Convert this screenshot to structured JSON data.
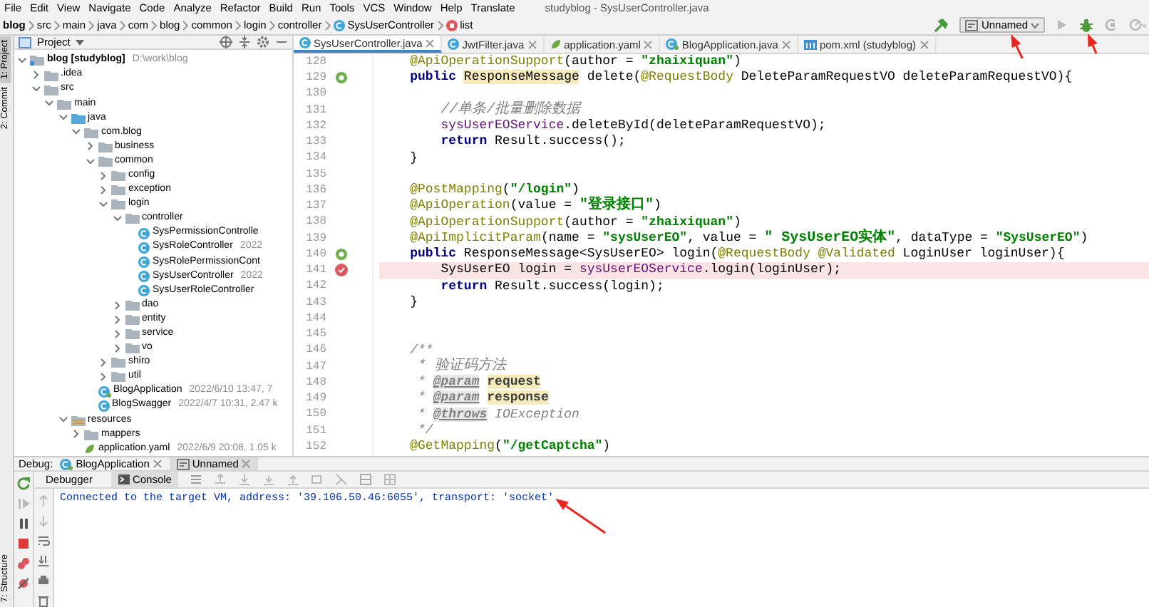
{
  "menu_bar": {
    "items": [
      "File",
      "Edit",
      "View",
      "Navigate",
      "Code",
      "Analyze",
      "Refactor",
      "Build",
      "Run",
      "Tools",
      "VCS",
      "Window",
      "Help",
      "Translate"
    ],
    "title": "studyblog - SysUserController.java"
  },
  "breadcrumbs": [
    {
      "label": "blog",
      "kind": "module"
    },
    {
      "label": "src",
      "kind": "folder"
    },
    {
      "label": "main",
      "kind": "folder"
    },
    {
      "label": "java",
      "kind": "folder"
    },
    {
      "label": "com",
      "kind": "folder"
    },
    {
      "label": "blog",
      "kind": "folder"
    },
    {
      "label": "common",
      "kind": "folder"
    },
    {
      "label": "login",
      "kind": "folder"
    },
    {
      "label": "controller",
      "kind": "folder"
    },
    {
      "label": "SysUserController",
      "kind": "class"
    },
    {
      "label": "list",
      "kind": "method"
    }
  ],
  "run_toolbar": {
    "configuration": "Unnamed"
  },
  "tool_stripe": {
    "top": [
      {
        "label": "1: Project",
        "selected": true
      },
      {
        "label": "2: Commit",
        "selected": false
      }
    ],
    "bottom": [
      {
        "label": "7: Structure",
        "selected": false
      }
    ]
  },
  "project_panel": {
    "title": "Project",
    "tree": [
      {
        "label": "blog [studyblog]",
        "kind": "module",
        "meta": "D:\\work\\blog",
        "expanded": true,
        "children": [
          {
            "label": ".idea",
            "kind": "folder",
            "expanded": false
          },
          {
            "label": "src",
            "kind": "folder",
            "expanded": true,
            "children": [
              {
                "label": "main",
                "kind": "folder",
                "expanded": true,
                "children": [
                  {
                    "label": "java",
                    "kind": "source",
                    "expanded": true,
                    "children": [
                      {
                        "label": "com.blog",
                        "kind": "folder",
                        "expanded": true,
                        "children": [
                          {
                            "label": "business",
                            "kind": "folder",
                            "expanded": false
                          },
                          {
                            "label": "common",
                            "kind": "folder",
                            "expanded": true,
                            "children": [
                              {
                                "label": "config",
                                "kind": "folder",
                                "expanded": false
                              },
                              {
                                "label": "exception",
                                "kind": "folder",
                                "expanded": false
                              },
                              {
                                "label": "login",
                                "kind": "folder",
                                "expanded": true,
                                "children": [
                                  {
                                    "label": "controller",
                                    "kind": "folder",
                                    "expanded": true,
                                    "children": [
                                      {
                                        "label": "SysPermissionControlle",
                                        "kind": "class"
                                      },
                                      {
                                        "label": "SysRoleController",
                                        "kind": "class",
                                        "meta": "2022"
                                      },
                                      {
                                        "label": "SysRolePermissionCont",
                                        "kind": "class"
                                      },
                                      {
                                        "label": "SysUserController",
                                        "kind": "class",
                                        "meta": "2022"
                                      },
                                      {
                                        "label": "SysUserRoleController",
                                        "kind": "class"
                                      }
                                    ]
                                  },
                                  {
                                    "label": "dao",
                                    "kind": "folder",
                                    "expanded": false
                                  },
                                  {
                                    "label": "entity",
                                    "kind": "folder",
                                    "expanded": false
                                  },
                                  {
                                    "label": "service",
                                    "kind": "folder",
                                    "expanded": false
                                  },
                                  {
                                    "label": "vo",
                                    "kind": "folder",
                                    "expanded": false
                                  }
                                ]
                              },
                              {
                                "label": "shiro",
                                "kind": "folder",
                                "expanded": false
                              },
                              {
                                "label": "util",
                                "kind": "folder",
                                "expanded": false
                              }
                            ]
                          },
                          {
                            "label": "BlogApplication",
                            "kind": "spring",
                            "meta": "2022/6/10 13:47, 7"
                          },
                          {
                            "label": "BlogSwagger",
                            "kind": "class",
                            "meta": "2022/4/7 10:31, 2.47 k"
                          }
                        ]
                      }
                    ]
                  },
                  {
                    "label": "resources",
                    "kind": "resources",
                    "expanded": true,
                    "children": [
                      {
                        "label": "mappers",
                        "kind": "folder",
                        "expanded": false
                      },
                      {
                        "label": "application.yaml",
                        "kind": "yaml",
                        "meta": "2022/6/9 20:08, 1.05 k"
                      }
                    ]
                  }
                ]
              }
            ]
          }
        ]
      }
    ]
  },
  "editor": {
    "tabs": [
      {
        "label": "SysUserController.java",
        "kind": "class",
        "selected": true
      },
      {
        "label": "JwtFilter.java",
        "kind": "class",
        "selected": false
      },
      {
        "label": "application.yaml",
        "kind": "yaml",
        "selected": false
      },
      {
        "label": "BlogApplication.java",
        "kind": "spring",
        "selected": false
      },
      {
        "label": "pom.xml (studyblog)",
        "kind": "maven",
        "selected": false
      }
    ],
    "lines": [
      {
        "number": "128",
        "kind": "plain",
        "breakpoint": false,
        "segments": [
          {
            "text": "    @ApiOperationSupport",
            "kind": "ann"
          },
          {
            "text": "(author = ",
            "kind": "plain"
          },
          {
            "text": "\"zhaixiquan\"",
            "kind": "str"
          },
          {
            "text": ")",
            "kind": "plain"
          }
        ]
      },
      {
        "number": "129",
        "kind": "bean",
        "breakpoint": false,
        "segments": [
          {
            "text": "    public",
            "kind": "kw"
          },
          {
            "text": " ResponseMessage",
            "kind": "hl"
          },
          {
            "text": " delete(",
            "kind": "plain"
          },
          {
            "text": "@RequestBody",
            "kind": "ann"
          },
          {
            "text": " DeleteParamRequestVO deleteParamRequestVO){",
            "kind": "plain"
          }
        ]
      },
      {
        "number": "130",
        "kind": "plain",
        "breakpoint": false
      },
      {
        "number": "131",
        "kind": "plain",
        "breakpoint": false,
        "segments": [
          {
            "text": "        //单条/批量删除数据",
            "kind": "cmt"
          }
        ]
      },
      {
        "number": "132",
        "kind": "plain",
        "breakpoint": false,
        "segments": [
          {
            "text": "        sysUserEOService",
            "kind": "field"
          },
          {
            "text": ".deleteById(deleteParamRequestVO);",
            "kind": "plain"
          }
        ]
      },
      {
        "number": "133",
        "kind": "plain",
        "breakpoint": false,
        "segments": [
          {
            "text": "        return",
            "kind": "kw"
          },
          {
            "text": " Result.success();",
            "kind": "plain"
          }
        ]
      },
      {
        "number": "134",
        "kind": "plain",
        "breakpoint": false,
        "segments": [
          {
            "text": "    }",
            "kind": "plain"
          }
        ]
      },
      {
        "number": "135",
        "kind": "plain",
        "breakpoint": false
      },
      {
        "number": "136",
        "kind": "plain",
        "breakpoint": false,
        "segments": [
          {
            "text": "    @PostMapping",
            "kind": "ann"
          },
          {
            "text": "(",
            "kind": "plain"
          },
          {
            "text": "\"/login\"",
            "kind": "str"
          },
          {
            "text": ")",
            "kind": "plain"
          }
        ]
      },
      {
        "number": "137",
        "kind": "plain",
        "breakpoint": false,
        "segments": [
          {
            "text": "    @ApiOperation",
            "kind": "ann"
          },
          {
            "text": "(value = ",
            "kind": "plain"
          },
          {
            "text": "\"登录接口\"",
            "kind": "str"
          },
          {
            "text": ")",
            "kind": "plain"
          }
        ]
      },
      {
        "number": "138",
        "kind": "plain",
        "breakpoint": false,
        "segments": [
          {
            "text": "    @ApiOperationSupport",
            "kind": "ann"
          },
          {
            "text": "(author = ",
            "kind": "plain"
          },
          {
            "text": "\"zhaixiquan\"",
            "kind": "str"
          },
          {
            "text": ")",
            "kind": "plain"
          }
        ]
      },
      {
        "number": "139",
        "kind": "plain",
        "breakpoint": false,
        "segments": [
          {
            "text": "    @ApiImplicitParam",
            "kind": "ann"
          },
          {
            "text": "(name = ",
            "kind": "plain"
          },
          {
            "text": "\"sysUserEO\"",
            "kind": "str"
          },
          {
            "text": ", value = ",
            "kind": "plain"
          },
          {
            "text": "\" SysUserEO实体\"",
            "kind": "str"
          },
          {
            "text": ", dataType = ",
            "kind": "plain"
          },
          {
            "text": "\"SysUserEO\"",
            "kind": "str"
          },
          {
            "text": ")",
            "kind": "plain"
          }
        ]
      },
      {
        "number": "140",
        "kind": "bean",
        "breakpoint": false,
        "segments": [
          {
            "text": "    public",
            "kind": "kw"
          },
          {
            "text": " ResponseMessage<SysUserEO> login(",
            "kind": "plain"
          },
          {
            "text": "@RequestBody",
            "kind": "ann"
          },
          {
            "text": " @Validated",
            "kind": "ann"
          },
          {
            "text": " LoginUser loginUser){",
            "kind": "plain"
          }
        ]
      },
      {
        "number": "141",
        "kind": "plain",
        "breakpoint": true,
        "segments": [
          {
            "text": "        SysUserEO login = ",
            "kind": "plain"
          },
          {
            "text": "sysUserEOService",
            "kind": "field"
          },
          {
            "text": ".login(loginUser);",
            "kind": "plain"
          }
        ]
      },
      {
        "number": "142",
        "kind": "plain",
        "breakpoint": false,
        "segments": [
          {
            "text": "        return",
            "kind": "kw"
          },
          {
            "text": " Result.success(login);",
            "kind": "plain"
          }
        ]
      },
      {
        "number": "143",
        "kind": "plain",
        "breakpoint": false,
        "segments": [
          {
            "text": "    }",
            "kind": "plain"
          }
        ]
      },
      {
        "number": "144",
        "kind": "plain",
        "breakpoint": false
      },
      {
        "number": "145",
        "kind": "plain",
        "breakpoint": false
      },
      {
        "number": "146",
        "kind": "plain",
        "breakpoint": false,
        "segments": [
          {
            "text": "    /**",
            "kind": "doc"
          }
        ]
      },
      {
        "number": "147",
        "kind": "plain",
        "breakpoint": false,
        "segments": [
          {
            "text": "     * 验证码方法",
            "kind": "doc"
          }
        ]
      },
      {
        "number": "148",
        "kind": "plain",
        "breakpoint": false,
        "segments": [
          {
            "text": "     * ",
            "kind": "doc"
          },
          {
            "text": "@param",
            "kind": "doctag"
          },
          {
            "text": " request",
            "kind": "docarg"
          }
        ]
      },
      {
        "number": "149",
        "kind": "plain",
        "breakpoint": false,
        "segments": [
          {
            "text": "     * ",
            "kind": "doc"
          },
          {
            "text": "@param",
            "kind": "doctag"
          },
          {
            "text": " response",
            "kind": "docarg"
          }
        ]
      },
      {
        "number": "150",
        "kind": "plain",
        "breakpoint": false,
        "segments": [
          {
            "text": "     * ",
            "kind": "doc"
          },
          {
            "text": "@throws",
            "kind": "doctag"
          },
          {
            "text": " IOException",
            "kind": "doc"
          }
        ]
      },
      {
        "number": "151",
        "kind": "plain",
        "breakpoint": false,
        "segments": [
          {
            "text": "     */",
            "kind": "doc"
          }
        ]
      },
      {
        "number": "152",
        "kind": "plain",
        "breakpoint": false,
        "segments": [
          {
            "text": "    @GetMapping",
            "kind": "ann"
          },
          {
            "text": "(",
            "kind": "plain"
          },
          {
            "text": "\"/getCaptcha\"",
            "kind": "str"
          },
          {
            "text": ")",
            "kind": "plain"
          }
        ]
      }
    ]
  },
  "debug_panel": {
    "label": "Debug:",
    "sessions": [
      {
        "label": "BlogApplication",
        "kind": "spring",
        "selected": false
      },
      {
        "label": "Unnamed",
        "kind": "config",
        "selected": true
      }
    ],
    "views": [
      {
        "label": "Debugger",
        "selected": false
      },
      {
        "label": "Console",
        "selected": true
      }
    ],
    "console": [
      "Connected to the target VM, address: '39.106.50.46:6055', transport: 'socket'"
    ]
  }
}
